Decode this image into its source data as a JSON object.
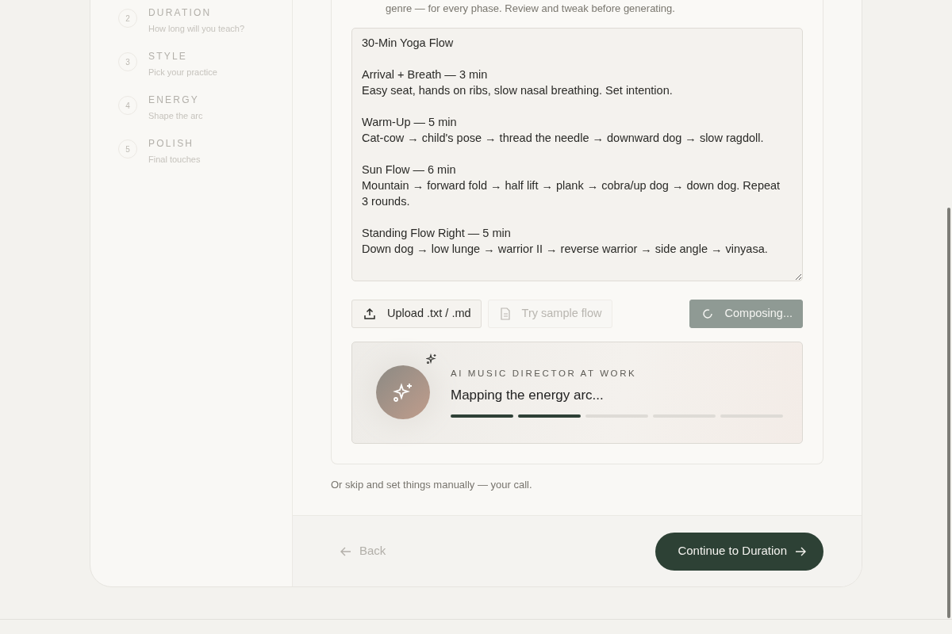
{
  "steps": [
    {
      "number": "2",
      "title": "DURATION",
      "subtitle": "How long will you teach?"
    },
    {
      "number": "3",
      "title": "STYLE",
      "subtitle": "Pick your practice"
    },
    {
      "number": "4",
      "title": "ENERGY",
      "subtitle": "Shape the arc"
    },
    {
      "number": "5",
      "title": "POLISH",
      "subtitle": "Final touches"
    }
  ],
  "intro": "genre — for every phase. Review and tweak before generating.",
  "flow_text": "30-Min Yoga Flow\n\nArrival + Breath — 3 min\nEasy seat, hands on ribs, slow nasal breathing. Set intention.\n\nWarm-Up — 5 min\nCat-cow → child's pose → thread the needle → downward dog → slow ragdoll.\n\nSun Flow — 6 min\nMountain → forward fold → half lift → plank → cobra/up dog → down dog. Repeat 3 rounds.\n\nStanding Flow Right — 5 min\nDown dog → low lunge → warrior II → reverse warrior → side angle → vinyasa.",
  "actions": [
    {
      "kind": "upload",
      "label": "Upload .txt / .md",
      "disabled": false
    },
    {
      "kind": "sample",
      "label": "Try sample flow",
      "disabled": true
    },
    {
      "kind": "compose",
      "label": "Composing...",
      "disabled": true
    }
  ],
  "status": {
    "eyebrow": "AI MUSIC DIRECTOR AT WORK",
    "message": "Mapping the energy arc...",
    "segments": [
      {
        "done": true
      },
      {
        "done": true
      },
      {
        "done": false
      },
      {
        "done": false
      },
      {
        "done": false
      }
    ]
  },
  "skip_note": "Or skip and set things manually — your call.",
  "footer": {
    "back": "Back",
    "continue": "Continue to Duration"
  }
}
